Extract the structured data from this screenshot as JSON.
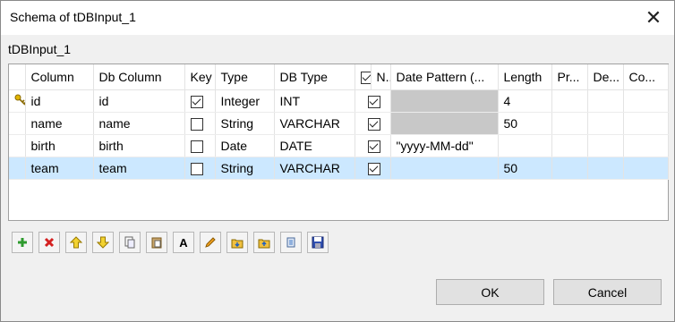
{
  "window": {
    "title": "Schema of tDBInput_1",
    "close_glyph": "✕"
  },
  "subtitle": "tDBInput_1",
  "table": {
    "headers": [
      "",
      "Column",
      "Db Column",
      "Key",
      "Type",
      "DB Type",
      "",
      "N..",
      "Date Pattern (...",
      "Length",
      "Pr...",
      "De...",
      "Co..."
    ],
    "rows": [
      {
        "column": "id",
        "db_column": "id",
        "key": true,
        "type": "Integer",
        "db_type": "INT",
        "nullable": true,
        "date_pattern": "",
        "length": "4"
      },
      {
        "column": "name",
        "db_column": "name",
        "key": false,
        "type": "String",
        "db_type": "VARCHAR",
        "nullable": true,
        "date_pattern": "",
        "length": "50"
      },
      {
        "column": "birth",
        "db_column": "birth",
        "key": false,
        "type": "Date",
        "db_type": "DATE",
        "nullable": true,
        "date_pattern": "\"yyyy-MM-dd\"",
        "length": ""
      },
      {
        "column": "team",
        "db_column": "team",
        "key": false,
        "type": "String",
        "db_type": "VARCHAR",
        "nullable": true,
        "date_pattern": "",
        "length": "50"
      }
    ]
  },
  "toolbar": {
    "icons": [
      "add-icon",
      "remove-icon",
      "move-up-icon",
      "move-down-icon",
      "copy-icon",
      "paste-icon",
      "text-icon",
      "edit-icon",
      "import-icon",
      "export-icon",
      "reset-icon",
      "save-icon"
    ],
    "text_label": "A"
  },
  "buttons": {
    "ok": "OK",
    "cancel": "Cancel"
  },
  "colors": {
    "selection": "#cce8ff",
    "disabled_cell": "#c8c8c8"
  }
}
